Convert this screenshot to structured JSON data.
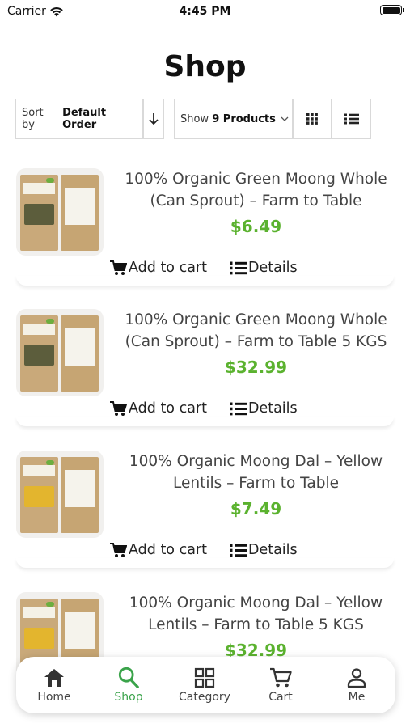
{
  "status_bar": {
    "carrier": "Carrier",
    "time": "4:45 PM"
  },
  "page": {
    "title": "Shop"
  },
  "toolbar": {
    "sort_prefix": "Sort by",
    "sort_value": "Default Order",
    "show_prefix": "Show",
    "show_value": "9 Products"
  },
  "products": [
    {
      "name": "100% Organic Green Moong Whole (Can Sprout) – Farm to Table",
      "price": "$6.49",
      "add_to_cart": "Add to cart",
      "details": "Details",
      "fill": "#5c5d3c"
    },
    {
      "name": "100% Organic Green Moong Whole (Can Sprout) – Farm to Table 5 KGS",
      "price": "$32.99",
      "add_to_cart": "Add to cart",
      "details": "Details",
      "fill": "#5c5d3c"
    },
    {
      "name": "100% Organic Moong Dal – Yellow Lentils – Farm to Table",
      "price": "$7.49",
      "add_to_cart": "Add to cart",
      "details": "Details",
      "fill": "#e3b52e"
    },
    {
      "name": "100% Organic Moong Dal – Yellow Lentils – Farm to Table 5 KGS",
      "price": "$32.99",
      "add_to_cart": "Add to cart",
      "details": "Details",
      "fill": "#e3b52e"
    }
  ],
  "bottom_nav": {
    "items": [
      {
        "label": "Home",
        "icon": "home-icon"
      },
      {
        "label": "Shop",
        "icon": "search-icon",
        "active": true
      },
      {
        "label": "Category",
        "icon": "category-icon"
      },
      {
        "label": "Cart",
        "icon": "cart-icon"
      },
      {
        "label": "Me",
        "icon": "person-icon"
      }
    ]
  },
  "colors": {
    "accent": "#5bb22f",
    "nav_active": "#3aa34a"
  }
}
